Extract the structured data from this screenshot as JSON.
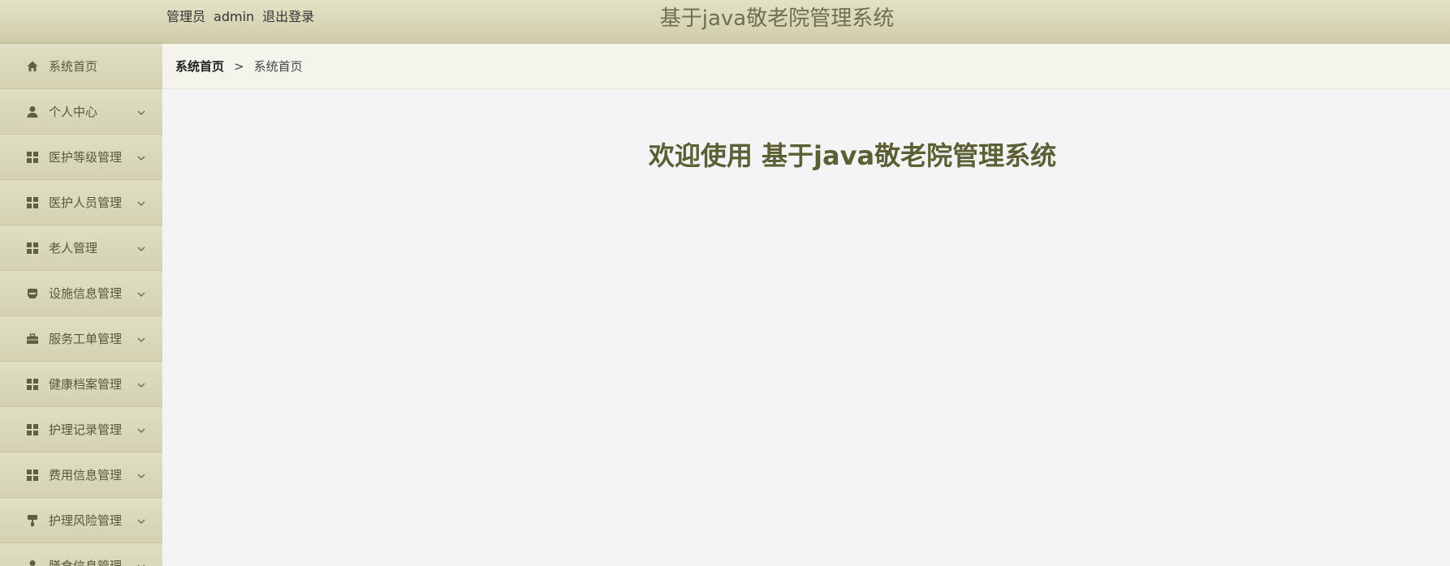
{
  "header": {
    "role_label": "管理员",
    "username": "admin",
    "logout_label": "退出登录",
    "title": "基于java敬老院管理系统"
  },
  "sidebar": {
    "items": [
      {
        "label": "系统首页",
        "icon": "home-icon",
        "has_chevron": false
      },
      {
        "label": "个人中心",
        "icon": "user-icon",
        "has_chevron": true
      },
      {
        "label": "医护等级管理",
        "icon": "grid-icon",
        "has_chevron": true
      },
      {
        "label": "医护人员管理",
        "icon": "grid-icon",
        "has_chevron": true
      },
      {
        "label": "老人管理",
        "icon": "grid-icon",
        "has_chevron": true
      },
      {
        "label": "设施信息管理",
        "icon": "inbox-icon",
        "has_chevron": true
      },
      {
        "label": "服务工单管理",
        "icon": "briefcase-icon",
        "has_chevron": true
      },
      {
        "label": "健康档案管理",
        "icon": "grid-icon",
        "has_chevron": true
      },
      {
        "label": "护理记录管理",
        "icon": "grid-icon",
        "has_chevron": true
      },
      {
        "label": "费用信息管理",
        "icon": "grid-icon",
        "has_chevron": true
      },
      {
        "label": "护理风险管理",
        "icon": "paint-roller-icon",
        "has_chevron": true
      },
      {
        "label": "膳食信息管理",
        "icon": "user-icon",
        "has_chevron": true
      }
    ]
  },
  "breadcrumb": {
    "home": "系统首页",
    "separator": ">",
    "current": "系统首页"
  },
  "main": {
    "welcome_text": "欢迎使用 基于java敬老院管理系统"
  },
  "colors": {
    "header_bg": "#d8d6b6",
    "sidebar_bg": "#d8d6b8",
    "accent_text": "#5c5f33",
    "main_bg": "#f3f4f6"
  }
}
